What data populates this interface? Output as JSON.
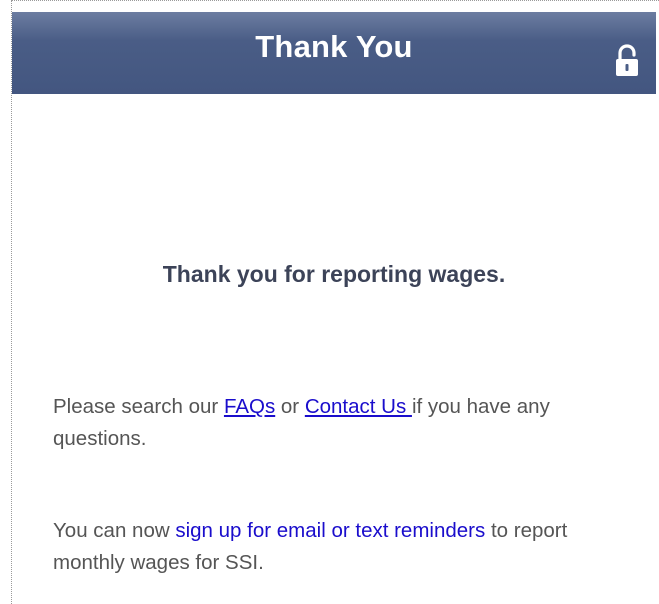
{
  "header": {
    "title": "Thank You",
    "lock_icon": "unlocked-padlock-icon"
  },
  "main": {
    "heading": "Thank you for reporting wages.",
    "help": {
      "prefix": "Please search our ",
      "faqs_link": "FAQs",
      "middle": " or ",
      "contact_link": "Contact Us ",
      "suffix": "if you have any questions."
    },
    "reminder": {
      "prefix": "You can now ",
      "signup_link": "sign up for email or text reminders",
      "suffix": " to report monthly wages for SSI."
    }
  },
  "colors": {
    "header_bg": "#4a5d86",
    "heading_text": "#3c4358",
    "body_text": "#555555",
    "link": "#1a0dcc"
  }
}
